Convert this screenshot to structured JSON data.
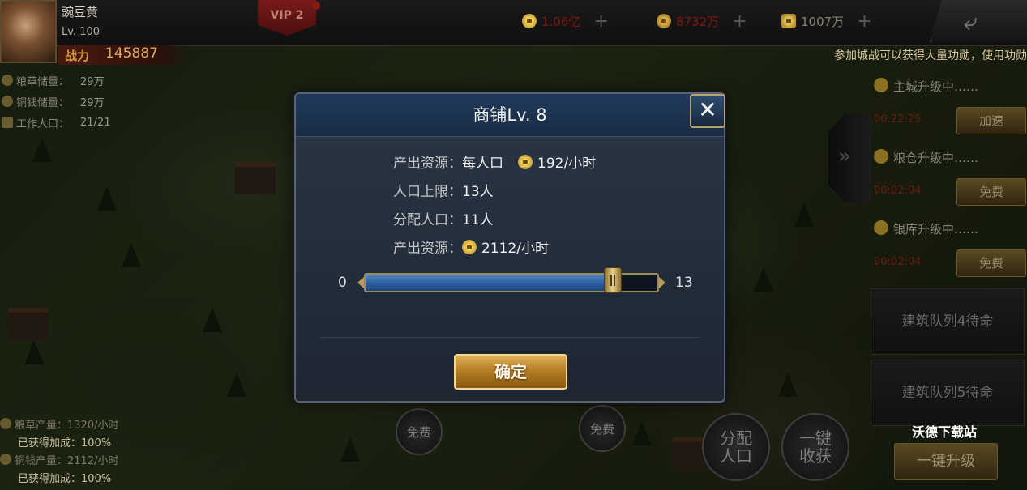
{
  "player": {
    "name": "豌豆黄",
    "level": "Lv. 100",
    "power_label": "战力",
    "power_value": "145887",
    "vip": "VIP 2"
  },
  "resources": [
    {
      "icon": "coin-icon",
      "value": "1.06亿"
    },
    {
      "icon": "grain-icon",
      "value": "8732万"
    },
    {
      "icon": "merit-icon",
      "value": "1007万"
    }
  ],
  "ticker": "参加城战可以获得大量功勋，使用功勋",
  "stats": [
    {
      "icon": "grain-icon",
      "label": "粮草储量：",
      "value": "29万"
    },
    {
      "icon": "coin-icon",
      "label": "铜钱储量：",
      "value": "29万"
    },
    {
      "icon": "worker-icon",
      "label": "工作人口：",
      "value": "21/21"
    }
  ],
  "production": [
    {
      "icon": "grain-icon",
      "label": "粮草产量：1320/小时",
      "bonus": "已获得加成：100%"
    },
    {
      "icon": "coin-icon",
      "label": "铜钱产量：2112/小时",
      "bonus": "已获得加成：100%"
    }
  ],
  "queue": [
    {
      "title": "主城升级中……",
      "time": "00:22:25",
      "button": "加速"
    },
    {
      "title": "粮仓升级中……",
      "time": "00:02:04",
      "button": "免费"
    },
    {
      "title": "银库升级中……",
      "time": "00:02:04",
      "button": "免费"
    }
  ],
  "queue_idle": [
    "建筑队列4待命",
    "建筑队列5待命"
  ],
  "bottom": {
    "free_1": "免费",
    "free_2": "免费",
    "assign": "分配\n人口",
    "harvest": "一键\n收获",
    "upgrade_all": "一键升级"
  },
  "watermark": "沃德下载站",
  "dialog": {
    "title": "商铺Lv. 8",
    "rows": [
      {
        "label": "产出资源：",
        "value_prefix": "每人口",
        "icon": "coin-icon",
        "value": "192/小时"
      },
      {
        "label": "人口上限：",
        "value": "13人"
      },
      {
        "label": "分配人口：",
        "value": "11人"
      },
      {
        "label": "产出资源：",
        "icon": "coin-icon",
        "value": "2112/小时"
      }
    ],
    "slider": {
      "min": "0",
      "max": "13",
      "value": 11
    },
    "confirm": "确定"
  }
}
